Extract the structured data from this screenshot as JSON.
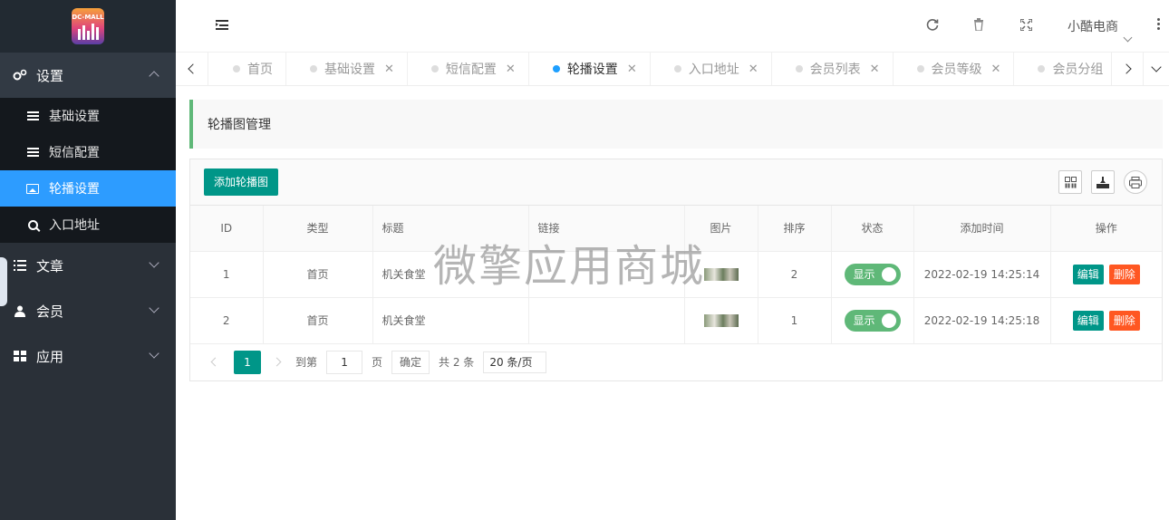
{
  "app": {
    "logo_text": "DC-MALL"
  },
  "sidebar": {
    "groups": [
      {
        "label": "设置",
        "icon": "gears-icon",
        "open": true
      },
      {
        "label": "文章",
        "icon": "list-icon"
      },
      {
        "label": "会员",
        "icon": "user-icon"
      },
      {
        "label": "应用",
        "icon": "grid-icon"
      }
    ],
    "settings_items": [
      {
        "label": "基础设置",
        "icon": "list-icon"
      },
      {
        "label": "短信配置",
        "icon": "list-icon"
      },
      {
        "label": "轮播设置",
        "icon": "image-icon",
        "active": true
      },
      {
        "label": "入口地址",
        "icon": "search-icon"
      }
    ]
  },
  "header": {
    "user_name": "小酷电商"
  },
  "tabs": [
    {
      "label": "首页",
      "closable": false
    },
    {
      "label": "基础设置"
    },
    {
      "label": "短信配置"
    },
    {
      "label": "轮播设置",
      "active": true
    },
    {
      "label": "入口地址"
    },
    {
      "label": "会员列表"
    },
    {
      "label": "会员等级"
    },
    {
      "label": "会员分组"
    }
  ],
  "page": {
    "title": "轮播图管理",
    "add_button": "添加轮播图"
  },
  "table": {
    "columns": [
      "ID",
      "类型",
      "标题",
      "链接",
      "图片",
      "排序",
      "状态",
      "添加时间",
      "操作"
    ],
    "rows": [
      {
        "id": "1",
        "type": "首页",
        "title": "机关食堂",
        "link": "",
        "sort": "2",
        "status": "显示",
        "time": "2022-02-19 14:25:14"
      },
      {
        "id": "2",
        "type": "首页",
        "title": "机关食堂",
        "link": "",
        "sort": "1",
        "status": "显示",
        "time": "2022-02-19 14:25:18"
      }
    ],
    "edit_label": "编辑",
    "delete_label": "删除"
  },
  "pager": {
    "current": "1",
    "goto_label": "到第",
    "page_value": "1",
    "page_unit": "页",
    "confirm": "确定",
    "total": "共 2 条",
    "page_size": "20 条/页"
  },
  "watermark": "微擎应用商城",
  "colors": {
    "sidebar_bg": "#2a3038",
    "active_blue": "#2d9cff",
    "primary_green": "#009688",
    "switch_green": "#5fb878",
    "danger": "#ff5722"
  }
}
